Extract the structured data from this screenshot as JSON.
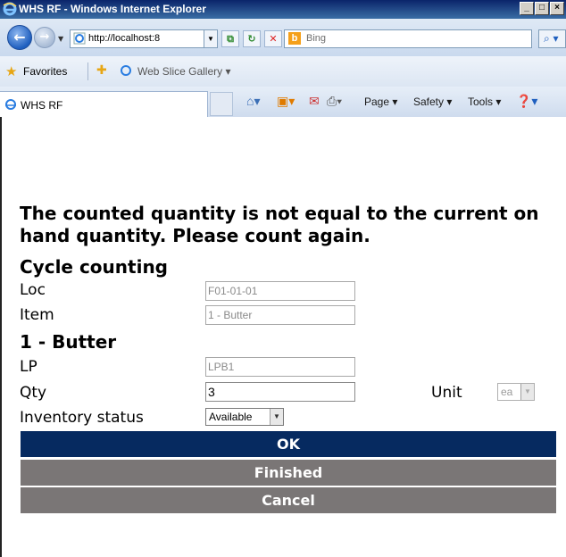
{
  "window": {
    "title": "WHS RF - Windows Internet Explorer"
  },
  "browser": {
    "url": "http://localhost:8",
    "search_placeholder": "Bing",
    "favorites_label": "Favorites",
    "web_slice_label": "Web Slice Gallery ▾",
    "tab_title": "WHS RF",
    "commands": {
      "page": "Page ▾",
      "safety": "Safety ▾",
      "tools": "Tools ▾"
    }
  },
  "page": {
    "message": "The counted quantity is not equal to the current on hand quantity. Please count again.",
    "section_title": "Cycle counting",
    "loc_label": "Loc",
    "loc_value": "F01-01-01",
    "item_label": "Item",
    "item_value": "1 - Butter",
    "item_heading": "1 - Butter",
    "lp_label": "LP",
    "lp_value": "LPB1",
    "qty_label": "Qty",
    "qty_value": "3",
    "unit_label": "Unit",
    "unit_value": "ea",
    "inv_status_label": "Inventory status",
    "inv_status_value": "Available",
    "ok_label": "OK",
    "finished_label": "Finished",
    "cancel_label": "Cancel"
  },
  "colors": {
    "ok_button": "#062a60",
    "grey_button": "#7a7676"
  }
}
